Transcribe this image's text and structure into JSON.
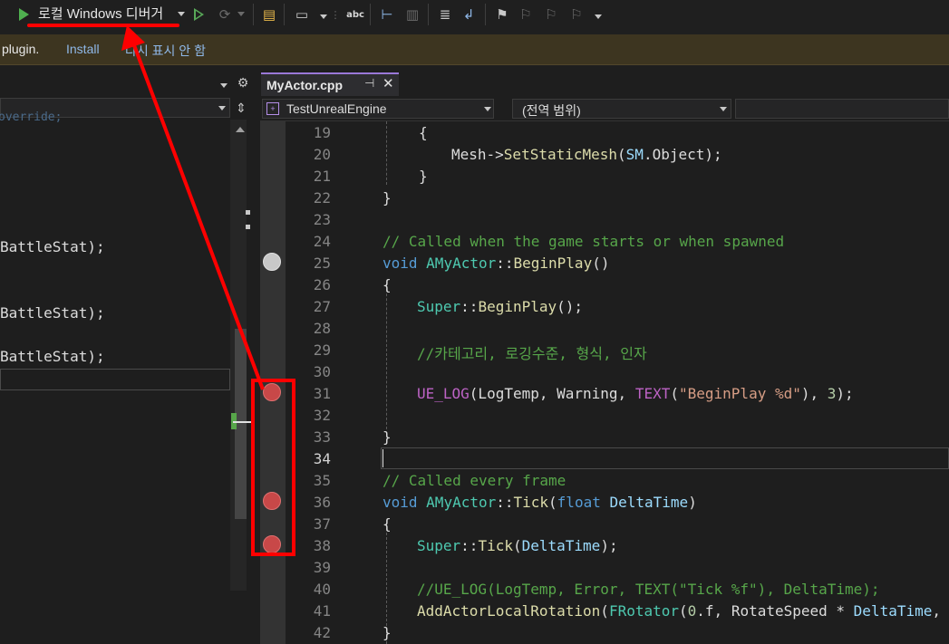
{
  "toolbar": {
    "debugger_label": "로컬 Windows 디버거"
  },
  "infobar": {
    "message": "plugin.",
    "install_link": "Install",
    "dismiss_link": "다시 표시 안 함"
  },
  "left_panel": {
    "code_lines": [
      {
        "text": "override;"
      },
      {
        "text": "BattleStat);"
      },
      {
        "text": "BattleStat);"
      },
      {
        "text": "BattleStat);"
      }
    ]
  },
  "editor": {
    "tab_title": "MyActor.cpp",
    "project_combo": "TestUnrealEngine",
    "scope_combo": "(전역 범위)",
    "line_numbers": [
      "19",
      "20",
      "21",
      "22",
      "23",
      "24",
      "25",
      "26",
      "27",
      "28",
      "29",
      "30",
      "31",
      "32",
      "33",
      "34",
      "35",
      "36",
      "37",
      "38",
      "39",
      "40",
      "41",
      "42"
    ],
    "current_line": "34",
    "breakpoints": {
      "disabled_line": "25",
      "active_lines": [
        "31",
        "36",
        "38"
      ]
    }
  },
  "colors": {
    "accent_purple": "#9a78d8",
    "breakpoint_red": "#c84848",
    "annotation_red": "#ff0000",
    "change_green": "#57a64a"
  }
}
